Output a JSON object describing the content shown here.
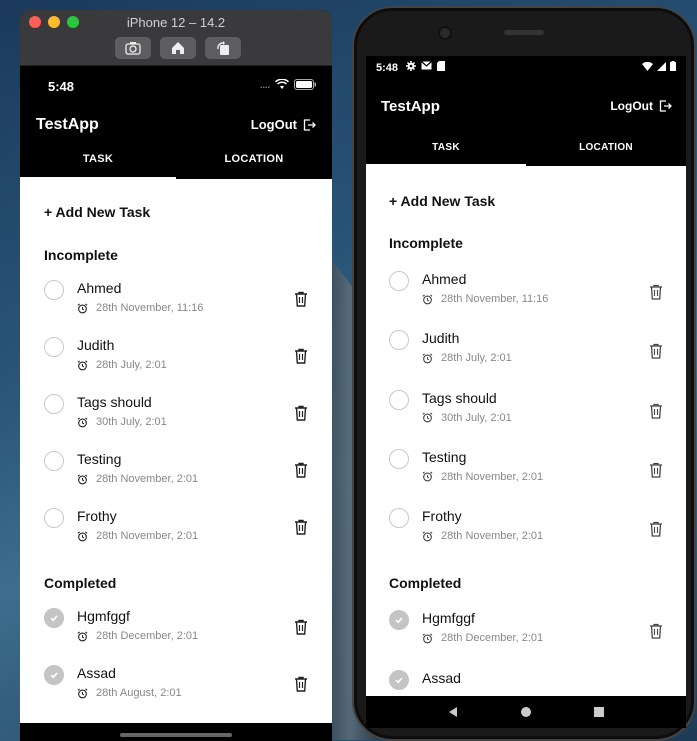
{
  "simulator": {
    "title": "iPhone 12 – 14.2",
    "buttons": [
      "screenshot",
      "home",
      "rotate"
    ]
  },
  "ios": {
    "status_time": "5:48",
    "app_title": "TestApp",
    "logout_label": "LogOut",
    "tabs": [
      "TASK",
      "LOCATION"
    ],
    "active_tab": "TASK",
    "add_task_label": "+ Add New Task",
    "incomplete_title": "Incomplete",
    "completed_title": "Completed",
    "incomplete_tasks": [
      {
        "name": "Ahmed",
        "time": "28th November, 11:16"
      },
      {
        "name": "Judith",
        "time": "28th July, 2:01"
      },
      {
        "name": "Tags should",
        "time": "30th July, 2:01"
      },
      {
        "name": "Testing",
        "time": "28th November, 2:01"
      },
      {
        "name": "Frothy",
        "time": "28th November, 2:01"
      }
    ],
    "completed_tasks": [
      {
        "name": "Hgmfggf",
        "time": "28th December, 2:01"
      },
      {
        "name": "Assad",
        "time": "28th August, 2:01"
      }
    ]
  },
  "android": {
    "status_time": "5:48",
    "app_title": "TestApp",
    "logout_label": "LogOut",
    "tabs": [
      "TASK",
      "LOCATION"
    ],
    "active_tab": "TASK",
    "add_task_label": "+ Add New Task",
    "incomplete_title": "Incomplete",
    "completed_title": "Completed",
    "incomplete_tasks": [
      {
        "name": "Ahmed",
        "time": "28th November, 11:16"
      },
      {
        "name": "Judith",
        "time": "28th July, 2:01"
      },
      {
        "name": "Tags should",
        "time": "30th July, 2:01"
      },
      {
        "name": "Testing",
        "time": "28th November, 2:01"
      },
      {
        "name": "Frothy",
        "time": "28th November, 2:01"
      }
    ],
    "completed_tasks": [
      {
        "name": "Hgmfggf",
        "time": "28th December, 2:01"
      },
      {
        "name": "Assad",
        "time": ""
      }
    ]
  },
  "colors": {
    "header_bg": "#000000",
    "checkbox_done": "#c4c4c4",
    "meta_text": "#888888"
  }
}
